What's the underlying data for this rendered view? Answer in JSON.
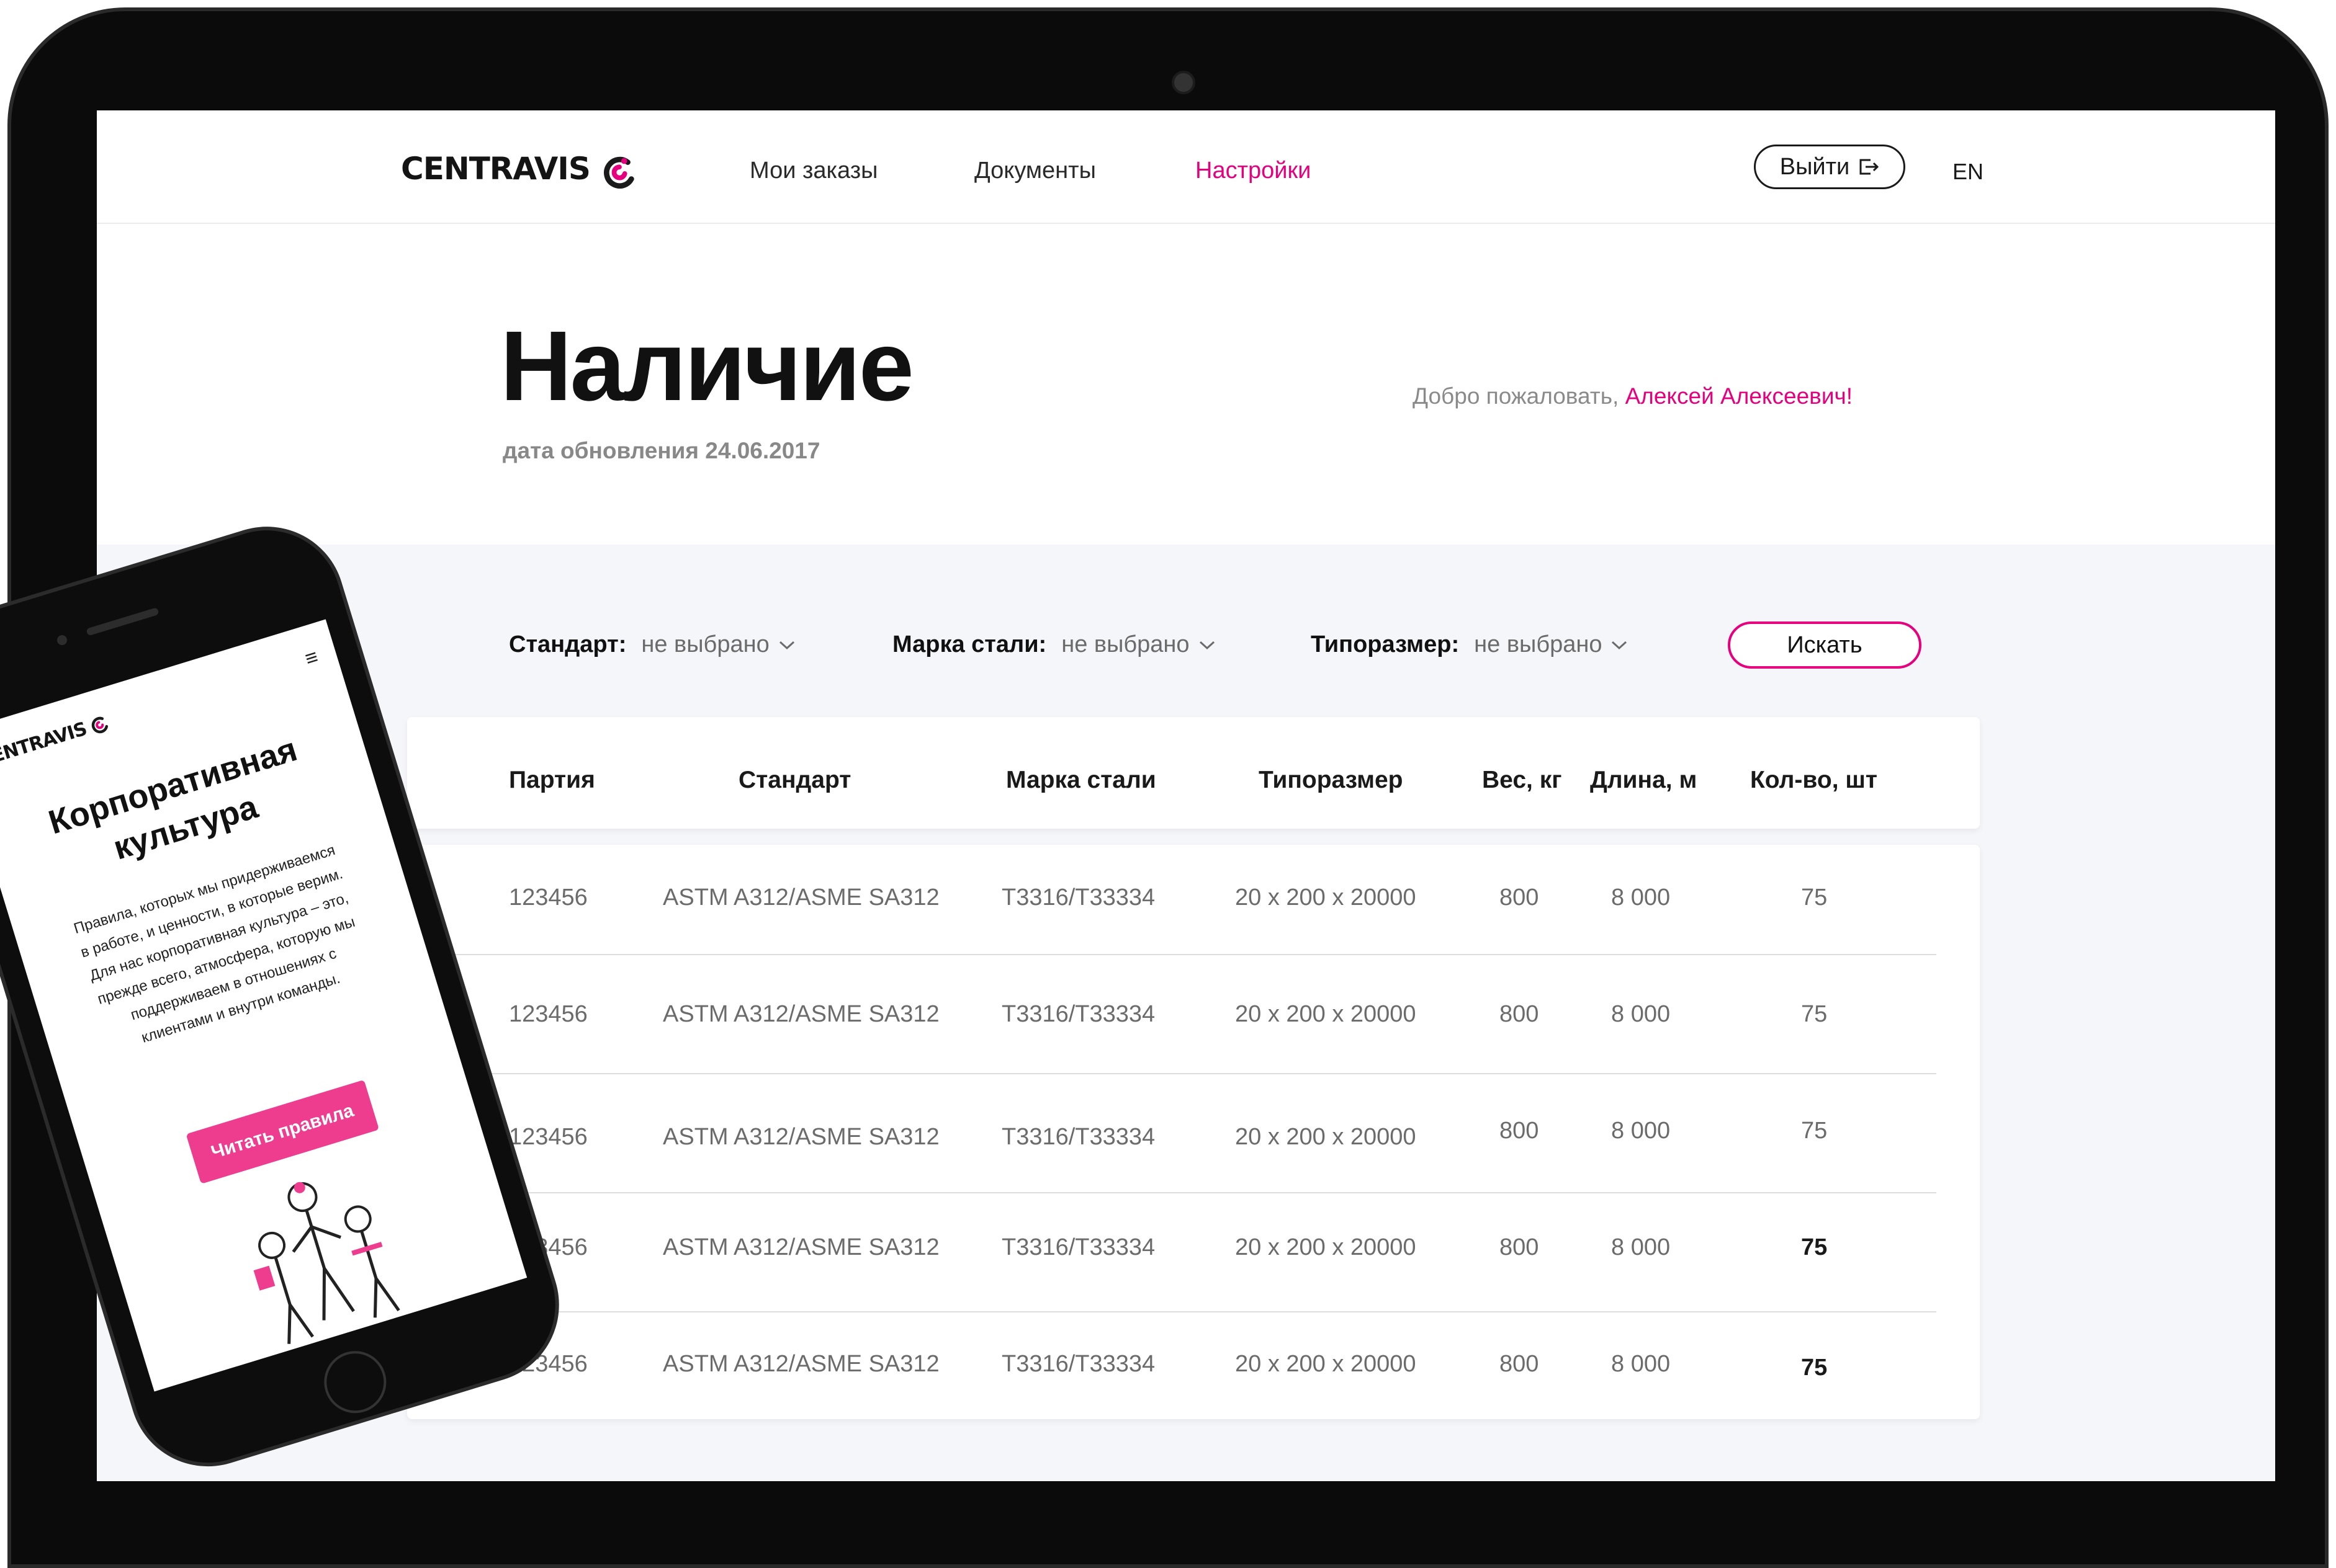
{
  "colors": {
    "accent": "#e6007e",
    "muted_text": "#6b6b6b",
    "panel_bg": "#f5f6fa"
  },
  "header": {
    "logo_text": "CENTRAVIS",
    "nav": [
      "Мои заказы",
      "Документы",
      "Настройки"
    ],
    "active_nav": "Настройки",
    "logout_label": "Выйти",
    "lang_label": "EN"
  },
  "page": {
    "title": "Наличие",
    "update_text": "дата обновления 24.06.2017",
    "welcome_prefix": "Добро пожаловать,",
    "welcome_name": "Алексей Алексеевич!"
  },
  "filters": [
    {
      "label": "Стандарт:",
      "value": "не выбрано"
    },
    {
      "label": "Марка стали:",
      "value": "не выбрано"
    },
    {
      "label": "Типоразмер:",
      "value": "не выбрано"
    }
  ],
  "search_label": "Искать",
  "table": {
    "columns": [
      "Партия",
      "Стандарт",
      "Марка стали",
      "Типоразмер",
      "Вес, кг",
      "Длина, м",
      "Кол-во, шт"
    ],
    "rows": [
      [
        "123456",
        "ASTM A312/ASME SA312",
        "T3316/T33334",
        "20 x 200 x 20000",
        "800",
        "8 000",
        "75"
      ],
      [
        "123456",
        "ASTM A312/ASME SA312",
        "T3316/T33334",
        "20 x 200 x 20000",
        "800",
        "8 000",
        "75"
      ],
      [
        "123456",
        "ASTM A312/ASME SA312",
        "T3316/T33334",
        "20 x 200 x 20000",
        "800",
        "8 000",
        "75"
      ],
      [
        "123456",
        "ASTM A312/ASME SA312",
        "T3316/T33334",
        "20 x 200 x 20000",
        "800",
        "8 000",
        "75"
      ],
      [
        "123456",
        "ASTM A312/ASME SA312",
        "T3316/T33334",
        "20 x 200 x 20000",
        "800",
        "8 000",
        "75"
      ]
    ]
  },
  "mobile": {
    "logo_text": "CENTRAVIS",
    "menu_icon": "hamburger-icon",
    "title": "Корпоративная культура",
    "text": "Правила, которых мы придерживаемся в работе, и ценности, в которые верим. Для нас корпоративная культура – это, прежде всего, атмосфера, которую мы поддерживаем в отношениях с клиентами и внутри команды.",
    "button": "Читать правила"
  }
}
